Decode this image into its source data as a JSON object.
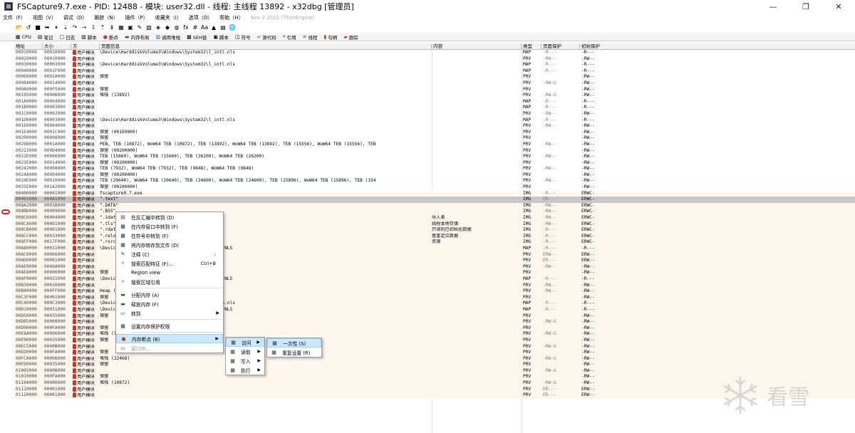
{
  "window": {
    "title": "FSCapture9.7.exe - PID: 12488 - 模块: user32.dll - 线程: 主线程 13892 - x32dbg [管理员]",
    "controls": [
      "—",
      "❐",
      "✕"
    ]
  },
  "menubar": {
    "items": [
      "文件（F）",
      "视图（V）",
      "调试（D）",
      "跟踪（N）",
      "插件（P）",
      "收藏夹（I）",
      "选项（O）",
      "帮助（H）"
    ],
    "build_info": "Nov 2 2023 (TitanEngine)"
  },
  "toolbar": {
    "icons": [
      "📂",
      "↺",
      "■",
      "➡",
      "⏸",
      "⇣",
      "↷",
      "⇢",
      "⇩",
      "⇡",
      "⇟",
      "▦",
      "▣",
      "✎",
      "▨",
      "◈",
      "◆",
      "◍",
      "fx",
      "#",
      "Aa",
      "▲",
      "▤",
      "🌐"
    ]
  },
  "tabs": [
    {
      "icon": "▦",
      "label": "CPU"
    },
    {
      "icon": "▤",
      "label": "笔记"
    },
    {
      "icon": "▢",
      "label": "日志"
    },
    {
      "icon": "▧",
      "label": "脚本"
    },
    {
      "icon": "●",
      "label": "断点"
    },
    {
      "icon": "▬",
      "label": "内存布局"
    },
    {
      "icon": "▥",
      "label": "调用堆栈"
    },
    {
      "icon": "▩",
      "label": "SEH链"
    },
    {
      "icon": "▣",
      "label": "脚本"
    },
    {
      "icon": "◫",
      "label": "符号"
    },
    {
      "icon": "‹›",
      "label": "源代码"
    },
    {
      "icon": "⌕",
      "label": "引用"
    },
    {
      "icon": "≋",
      "label": "线程"
    },
    {
      "icon": "▮",
      "label": "句柄"
    },
    {
      "icon": "▰",
      "label": "跟踪"
    }
  ],
  "table": {
    "headers": [
      "地址",
      "大小",
      "方",
      "页面信息",
      "内容",
      "类型",
      "页面保护",
      "初始保护"
    ],
    "rows": [
      [
        "00010000",
        "00010000",
        "用户模块",
        "\\Device\\HarddiskVolume3\\Windows\\System32\\l_intl.nls",
        "",
        "MAP",
        "-R---",
        "-R---"
      ],
      [
        "00020000",
        "00010000",
        "用户模块",
        "",
        "",
        "PRV",
        "-RW--",
        "-RW--"
      ],
      [
        "00030000",
        "00003000",
        "用户模块",
        "\\Device\\HarddiskVolume3\\Windows\\System32\\l_intl.nls",
        "",
        "MAP",
        "-R---",
        "-R---"
      ],
      [
        "00040000",
        "0001F000",
        "用户模块",
        "",
        "",
        "MAP",
        "-R---",
        "-R---"
      ],
      [
        "00060000",
        "0002A000",
        "用户模块",
        "保留",
        "",
        "PRV",
        "",
        "-RW--"
      ],
      [
        "0008A000",
        "00014000",
        "用户模块",
        "",
        "",
        "PRV",
        "-RW-G",
        "-RW--"
      ],
      [
        "000A0000",
        "000F5000",
        "用户模块",
        "保留",
        "",
        "PRV",
        "",
        "-RW--"
      ],
      [
        "00195000",
        "0000B000",
        "用户模块",
        "堆栈 (13892)",
        "",
        "PRV",
        "-RW-G",
        "-RW--"
      ],
      [
        "001A0000",
        "00004000",
        "用户模块",
        "",
        "",
        "MAP",
        "-R---",
        "-R---"
      ],
      [
        "001B0000",
        "00003000",
        "用户模块",
        "",
        "",
        "MAP",
        "-R---",
        "-R---"
      ],
      [
        "001C0000",
        "00002000",
        "用户模块",
        "",
        "",
        "PRV",
        "-RW--",
        "-RW--"
      ],
      [
        "001D0000",
        "00003000",
        "用户模块",
        "\\Device\\HarddiskVolume3\\Windows\\System32\\l_intl.nls",
        "",
        "MAP",
        "-R---",
        "-R---"
      ],
      [
        "001E0000",
        "00004000",
        "用户模块",
        "",
        "",
        "PRV",
        "-RW--",
        "-RW--"
      ],
      [
        "001E4000",
        "0001C000",
        "用户模块",
        "保留 (001E0000)",
        "",
        "PRV",
        "",
        "-RW--"
      ],
      [
        "00200000",
        "00008000",
        "用户模块",
        "保留",
        "",
        "PRV",
        "",
        "-RW--"
      ],
      [
        "00208000",
        "0001A000",
        "用户模块",
        "PEB, TEB (10872), WoW64 TEB (10872), TEB (13892), WoW64 TEB (13892), TEB (15556), WoW64 TEB (15556), TEB",
        "",
        "PRV",
        "-RW--",
        "-RW--"
      ],
      [
        "00222000",
        "000D4000",
        "用户模块",
        "保留 (00200000)",
        "",
        "PRV",
        "",
        "-RW--"
      ],
      [
        "0022E000",
        "00006000",
        "用户模块",
        "TEB (15660), WoW64 TEB (15660), TEB (26200), WoW64 TEB (26200)",
        "",
        "PRV",
        "-RW--",
        "-RW--"
      ],
      [
        "0023E000",
        "00014000",
        "用户模块",
        "保留 (00200000)",
        "",
        "PRV",
        "",
        "-RW--"
      ],
      [
        "00242000",
        "00008000",
        "用户模块",
        "TEB (7932), WoW64 TEB (7932), TEB (9848), WoW64 TEB (9848)",
        "",
        "PRV",
        "-RW--",
        "-RW--"
      ],
      [
        "0024A000",
        "00004000",
        "用户模块",
        "保留 (00200000)",
        "",
        "PRV",
        "",
        "-RW--"
      ],
      [
        "0024E000",
        "00010000",
        "用户模块",
        "TEB (20640), WoW64 TEB (20640), TEB (24600), WoW64 TEB (24600), TEB (15896), WoW64 TEB (15896), TEB (154",
        "",
        "PRV",
        "-RW--",
        "-RW--"
      ],
      [
        "0025E000",
        "001A2000",
        "用户模块",
        "保留 (00200000)",
        "",
        "PRV",
        "",
        "-RW--"
      ],
      [
        "00400000",
        "00001000",
        "用户模块",
        "fscapture9.7.exe",
        "",
        "IMG",
        "-R---",
        "ERWC-"
      ],
      [
        "00401000",
        "004A1000",
        "用户模块",
        "\".text\"",
        "",
        "IMG",
        "ER---",
        "ERWC-"
      ],
      [
        "008A2000",
        "0001B000",
        "用户模块",
        "\".DATA\"",
        "",
        "IMG",
        "-RW--",
        "ERWC-"
      ],
      [
        "008BD000",
        "00009000",
        "用户模块",
        "\".BSS\"",
        "",
        "IMG",
        "-RW--",
        "ERWC-"
      ],
      [
        "008C6000",
        "00004000",
        "用户模块",
        "\".idata\"",
        "导入表",
        "IMG",
        "-RW--",
        "ERWC-"
      ],
      [
        "008CA000",
        "00001000",
        "用户模块",
        "\".tls\"",
        "线程本地存储",
        "IMG",
        "-RW--",
        "ERWC-"
      ],
      [
        "008CB000",
        "00001000",
        "用户模块",
        "\".rdata\"",
        "只读的已初始化数据",
        "IMG",
        "-R---",
        "ERWC-"
      ],
      [
        "008CC000",
        "00033000",
        "用户模块",
        "\".reloc\"",
        "基重定位数据",
        "IMG",
        "-R---",
        "ERWC-"
      ],
      [
        "008FF000",
        "0017F000",
        "用户模块",
        "\".rsrc\"",
        "资源",
        "IMG",
        "-R---",
        "ERWC-"
      ],
      [
        "00A80000",
        "00031000",
        "用户模块",
        "\\Device\\HarddiskVolume3\\Windows\\System32\\C_936.NLS",
        "",
        "MAP",
        "-R---",
        "-R---"
      ],
      [
        "00AC0000",
        "00006000",
        "用户模块",
        "",
        "",
        "PRV",
        "ERW--",
        "ERW--"
      ],
      [
        "00AD0000",
        "00001000",
        "用户模块",
        "",
        "",
        "PRV",
        "ER---",
        "ERW--"
      ],
      [
        "00AE0000",
        "0000A000",
        "用户模块",
        "",
        "",
        "PRV",
        "-RW--",
        "-RW--"
      ],
      [
        "00AEA000",
        "00006000",
        "用户模块",
        "保留",
        "",
        "PRV",
        "",
        "-RW--"
      ],
      [
        "00AF0000",
        "00031000",
        "用户模块",
        "\\Device\\HarddiskVolume3\\Windows\\System32\\C_936.NLS",
        "",
        "MAP",
        "-R---",
        "-R---"
      ],
      [
        "00B30000",
        "00010000",
        "用户模块",
        "",
        "",
        "PRV",
        "-RW--",
        "-RW--"
      ],
      [
        "00B40000",
        "000FF000",
        "用户模块",
        "Heap (ID 2)",
        "",
        "PRV",
        "-RW--",
        "-RW--"
      ],
      [
        "00C3F000",
        "00001000",
        "用户模块",
        "保留",
        "",
        "PRV",
        "",
        "-RW--"
      ],
      [
        "00C40000",
        "000C3000",
        "用户模块",
        "\\Device\\HarddiskVolume3\\Windows\\System32\\locale.nls",
        "",
        "MAP",
        "-R---",
        "-R---"
      ],
      [
        "00D10000",
        "00031000",
        "用户模块",
        "\\Device\\HarddiskVolume3\\Windows\\System32\\C_936.NLS",
        "",
        "MAP",
        "-R---",
        "-R---"
      ],
      [
        "00D50000",
        "00035000",
        "用户模块",
        "保留",
        "",
        "PRV",
        "",
        "-RW--"
      ],
      [
        "00D85000",
        "00008000",
        "用户模块",
        "",
        "",
        "PRV",
        "-RW-G",
        "-RW--"
      ],
      [
        "00D90000",
        "000FA000",
        "用户模块",
        "保留",
        "",
        "PRV",
        "",
        "-RW--"
      ],
      [
        "00E8A000",
        "00006000",
        "用户模块",
        "堆栈 (15556)",
        "",
        "PRV",
        "-RW-G",
        "-RW--"
      ],
      [
        "00E90000",
        "00035000",
        "用户模块",
        "保留",
        "",
        "PRV",
        "",
        "-RW--"
      ],
      [
        "00EC5000",
        "0000B000",
        "用户模块",
        "",
        "",
        "PRV",
        "-RW-G",
        "-RW--"
      ],
      [
        "00ED0000",
        "000FA000",
        "用户模块",
        "保留",
        "",
        "PRV",
        "",
        "-RW--"
      ],
      [
        "00FCA000",
        "00006000",
        "用户模块",
        "堆栈 (22468)",
        "",
        "PRV",
        "-RW-G",
        "-RW--"
      ],
      [
        "00FD0000",
        "00035000",
        "用户模块",
        "保留",
        "",
        "PRV",
        "",
        "-RW--"
      ],
      [
        "01005000",
        "0000B000",
        "用户模块",
        "",
        "",
        "PRV",
        "-RW-G",
        "-RW--"
      ],
      [
        "01010000",
        "000FA000",
        "用户模块",
        "保留",
        "",
        "PRV",
        "",
        "-RW--"
      ],
      [
        "0110A000",
        "00006000",
        "用户模块",
        "堆栈 (10872)",
        "",
        "PRV",
        "-RW-G",
        "-RW--"
      ],
      [
        "01110000",
        "00001000",
        "用户模块",
        "",
        "",
        "PRV",
        "ER---",
        "ERW--"
      ],
      [
        "01120000",
        "00001000",
        "用户模块",
        "",
        "",
        "PRV",
        "ER---",
        "ERW--"
      ]
    ]
  },
  "context_menu": {
    "items": [
      {
        "icon": "▤",
        "label": "在反汇编中转到 (D)",
        "shortcut": ""
      },
      {
        "icon": "▦",
        "label": "在内存窗口中转到 (F)",
        "shortcut": ""
      },
      {
        "icon": "▦",
        "label": "在符号中转到 (F)",
        "shortcut": ""
      },
      {
        "icon": "▦",
        "label": "将内存转存到文件 (D)",
        "shortcut": ""
      },
      {
        "icon": "✎",
        "label": "注释 (C)",
        "shortcut": ";"
      },
      {
        "icon": "⌕",
        "label": "搜索匹配特征 (F)...",
        "shortcut": "Ctrl+B"
      },
      {
        "icon": "",
        "label": "Region view",
        "shortcut": ""
      },
      {
        "icon": "⌕",
        "label": "搜索区域引用",
        "shortcut": ""
      },
      {
        "icon": "▬",
        "label": "分配内存 (A)",
        "shortcut": ""
      },
      {
        "icon": "▬",
        "label": "释放内存 (F)",
        "shortcut": ""
      },
      {
        "icon": "▭",
        "label": "转到",
        "shortcut": ""
      },
      {
        "icon": "▦",
        "label": "设置内存保护权限",
        "shortcut": ""
      },
      {
        "icon": "●",
        "label": "内存断点 (B)",
        "shortcut": ""
      },
      {
        "icon": "▭",
        "label": "窗口中...",
        "shortcut": ""
      }
    ]
  },
  "submenu": {
    "items": [
      "访问",
      "读取",
      "写入",
      "执行"
    ]
  },
  "submenu2": {
    "items": [
      "一次性 (S)",
      "重复设置 (R)"
    ]
  },
  "watermark": {
    "text": "看雪"
  },
  "colors": {
    "row_tint": "#fff7ee",
    "selected_row": "#c7c7c7",
    "menu_highlight": "#cce8ff",
    "marker": "#e02020"
  }
}
